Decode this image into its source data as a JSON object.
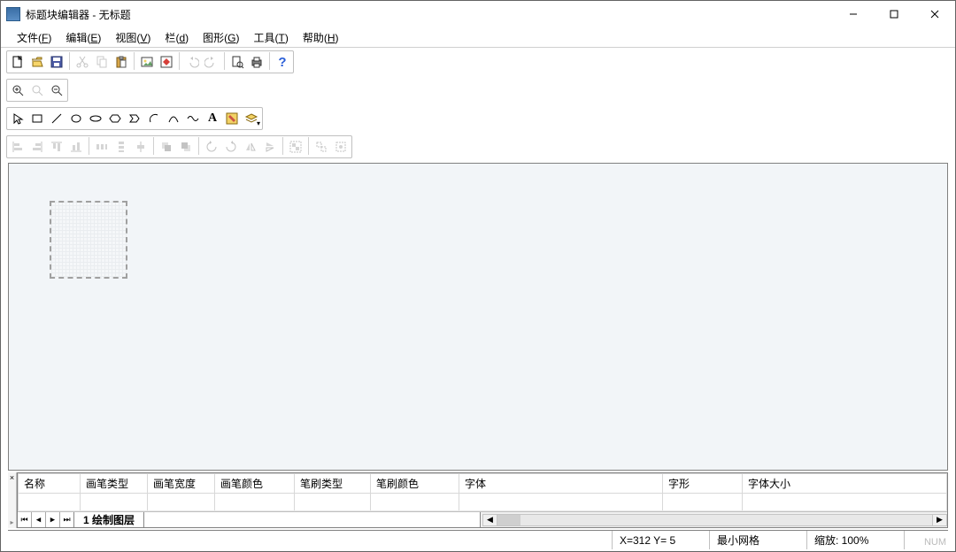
{
  "titlebar": {
    "title": "标题块编辑器 - 无标题"
  },
  "menubar": {
    "file": {
      "label": "文件",
      "accel": "F"
    },
    "edit": {
      "label": "编辑",
      "accel": "E"
    },
    "view": {
      "label": "视图",
      "accel": "V"
    },
    "column": {
      "label": "栏",
      "accel": "d"
    },
    "shape": {
      "label": "图形",
      "accel": "G"
    },
    "tools": {
      "label": "工具",
      "accel": "T"
    },
    "help": {
      "label": "帮助",
      "accel": "H"
    }
  },
  "toolbar": {
    "new": "new",
    "open": "open",
    "save": "save",
    "cut": "cut",
    "copy": "copy",
    "paste": "paste",
    "image": "image",
    "recolor": "recolor",
    "undo": "undo",
    "redo": "redo",
    "preview": "preview",
    "print": "print",
    "help": "?"
  },
  "zoom": {
    "in": "zoom-in",
    "auto": "zoom-auto",
    "out": "zoom-out"
  },
  "shapes": {
    "select": "select",
    "rect": "rect",
    "line": "line",
    "ellipse": "ellipse",
    "oval": "oval",
    "hex": "hex",
    "chevron": "chevron",
    "arc": "arc",
    "curve": "curve",
    "wave": "wave",
    "text": "A",
    "fill": "fill",
    "layers": "layers"
  },
  "table": {
    "columns": [
      "名称",
      "画笔类型",
      "画笔宽度",
      "画笔颜色",
      "笔刷类型",
      "笔刷颜色",
      "字体",
      "字形",
      "字体大小"
    ]
  },
  "tabs": {
    "layer1": "1  绘制图层"
  },
  "status": {
    "coords": "X=312 Y=  5",
    "grid": "最小网格",
    "zoom": "缩放:  100%",
    "indicator": "NUM"
  }
}
